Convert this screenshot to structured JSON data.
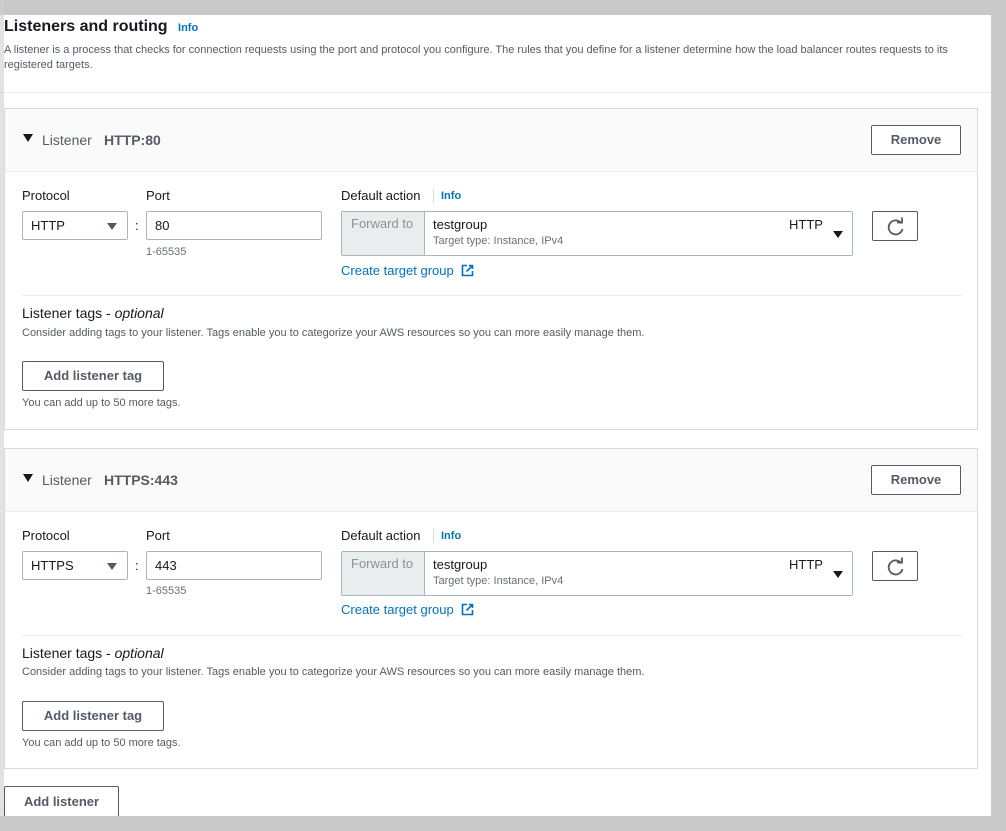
{
  "section": {
    "title": "Listeners and routing",
    "info": "Info",
    "description": "A listener is a process that checks for connection requests using the port and protocol you configure. The rules that you define for a listener determine how the load balancer routes requests to its registered targets."
  },
  "listeners": [
    {
      "label": "Listener",
      "name": "HTTP:80",
      "remove": "Remove",
      "protocol_label": "Protocol",
      "protocol": "HTTP",
      "port_label": "Port",
      "port": "80",
      "port_hint": "1-65535",
      "default_action_label": "Default action",
      "info": "Info",
      "forward_to": "Forward to",
      "target_group": "testgroup",
      "target_type": "Target type: Instance, IPv4",
      "target_protocol": "HTTP",
      "create_target_group": "Create target group",
      "tags_title": "Listener tags - ",
      "tags_optional": "optional",
      "tags_desc": "Consider adding tags to your listener. Tags enable you to categorize your AWS resources so you can more easily manage them.",
      "add_tag": "Add listener tag",
      "tags_hint": "You can add up to 50 more tags."
    },
    {
      "label": "Listener",
      "name": "HTTPS:443",
      "remove": "Remove",
      "protocol_label": "Protocol",
      "protocol": "HTTPS",
      "port_label": "Port",
      "port": "443",
      "port_hint": "1-65535",
      "default_action_label": "Default action",
      "info": "Info",
      "forward_to": "Forward to",
      "target_group": "testgroup",
      "target_type": "Target type: Instance, IPv4",
      "target_protocol": "HTTP",
      "create_target_group": "Create target group",
      "tags_title": "Listener tags - ",
      "tags_optional": "optional",
      "tags_desc": "Consider adding tags to your listener. Tags enable you to categorize your AWS resources so you can more easily manage them.",
      "add_tag": "Add listener tag",
      "tags_hint": "You can add up to 50 more tags."
    }
  ],
  "add_listener": "Add listener",
  "colors": {
    "link": "#0073bb",
    "text": "#16191f",
    "muted": "#545b64",
    "border": "#aab7b8"
  },
  "icons": [
    "caret-down-icon",
    "chevron-down-icon",
    "refresh-icon",
    "external-link-icon"
  ]
}
